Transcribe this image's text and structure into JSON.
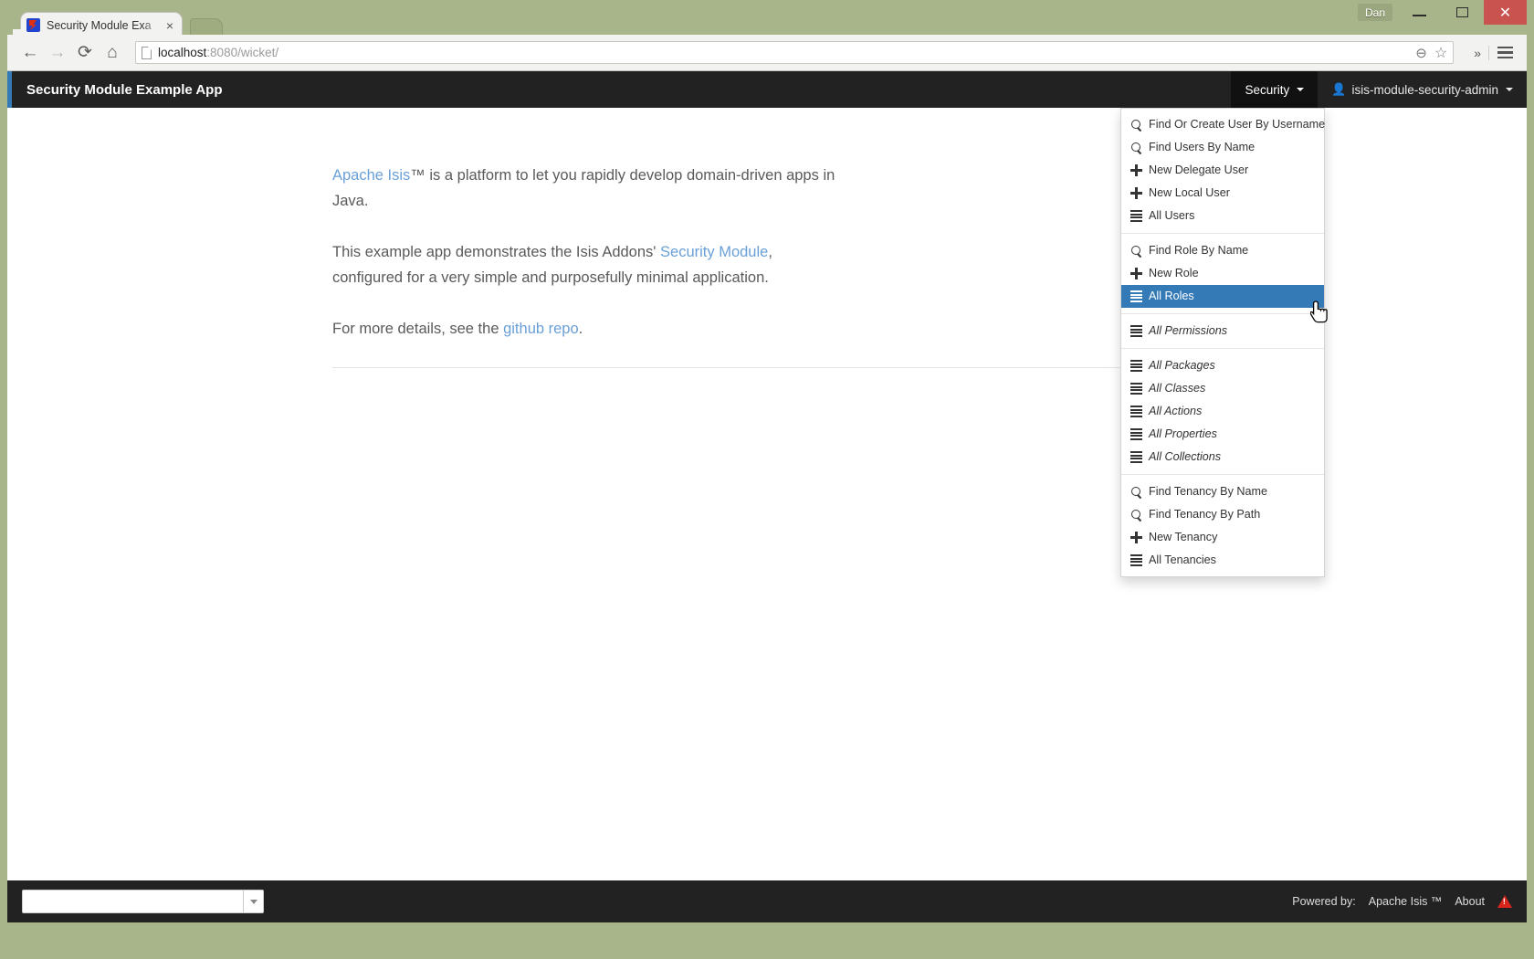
{
  "browser": {
    "tab": {
      "title": "Security Module Exa",
      "close_label": "×",
      "favicon": "isis-favicon"
    },
    "new_tab_label": "",
    "window_controls": {
      "user_label": "Dan",
      "minimize_label": "—",
      "maximize_label": "",
      "close_label": "✕"
    },
    "toolbar": {
      "back_label": "←",
      "forward_label": "→",
      "reload_label": "⟳",
      "home_label": "⌂",
      "url_host": "localhost",
      "url_rest": ":8080/wicket/",
      "zoom_icon_label": "⊖",
      "bookmark_icon_label": "☆",
      "overflow_label": "»",
      "menu_label": ""
    }
  },
  "app": {
    "brand": "Security Module Example App",
    "accent_color": "#337ab7",
    "navbar_background": "#222222",
    "nav": {
      "security_label": "Security",
      "user_label": "isis-module-security-admin"
    }
  },
  "dropdown": {
    "groups": [
      {
        "items": [
          {
            "label": "Find Or Create User By Username",
            "icon": "search-icon",
            "italic": false,
            "active": false
          },
          {
            "label": "Find Users By Name",
            "icon": "search-icon",
            "italic": false,
            "active": false
          },
          {
            "label": "New Delegate User",
            "icon": "plus-icon",
            "italic": false,
            "active": false
          },
          {
            "label": "New Local User",
            "icon": "plus-icon",
            "italic": false,
            "active": false
          },
          {
            "label": "All Users",
            "icon": "list-icon",
            "italic": false,
            "active": false
          }
        ]
      },
      {
        "items": [
          {
            "label": "Find Role By Name",
            "icon": "search-icon",
            "italic": false,
            "active": false
          },
          {
            "label": "New Role",
            "icon": "plus-icon",
            "italic": false,
            "active": false
          },
          {
            "label": "All Roles",
            "icon": "list-icon",
            "italic": false,
            "active": true
          }
        ]
      },
      {
        "items": [
          {
            "label": "All Permissions",
            "icon": "list-icon",
            "italic": true,
            "active": false
          }
        ]
      },
      {
        "items": [
          {
            "label": "All Packages",
            "icon": "list-icon",
            "italic": true,
            "active": false
          },
          {
            "label": "All Classes",
            "icon": "list-icon",
            "italic": true,
            "active": false
          },
          {
            "label": "All Actions",
            "icon": "list-icon",
            "italic": true,
            "active": false
          },
          {
            "label": "All Properties",
            "icon": "list-icon",
            "italic": true,
            "active": false
          },
          {
            "label": "All Collections",
            "icon": "list-icon",
            "italic": true,
            "active": false
          }
        ]
      },
      {
        "items": [
          {
            "label": "Find Tenancy By Name",
            "icon": "search-icon",
            "italic": false,
            "active": false
          },
          {
            "label": "Find Tenancy By Path",
            "icon": "search-icon",
            "italic": false,
            "active": false
          },
          {
            "label": "New Tenancy",
            "icon": "plus-icon",
            "italic": false,
            "active": false
          },
          {
            "label": "All Tenancies",
            "icon": "list-icon",
            "italic": false,
            "active": false
          }
        ]
      }
    ],
    "highlight_color": "#337ab7"
  },
  "content": {
    "paragraphs": [
      {
        "parts": [
          {
            "text": "Apache Isis",
            "link": true
          },
          {
            "text": "™ is a platform to let you rapidly develop domain-driven apps in Java.",
            "link": false
          }
        ]
      },
      {
        "parts": [
          {
            "text": "This example app demonstrates the Isis Addons' ",
            "link": false
          },
          {
            "text": "Security Module",
            "link": true
          },
          {
            "text": ", configured for a very simple and purposefully minimal application.",
            "link": false
          }
        ]
      },
      {
        "parts": [
          {
            "text": "For more details, see the ",
            "link": false
          },
          {
            "text": "github repo",
            "link": true
          },
          {
            "text": ".",
            "link": false
          }
        ]
      }
    ]
  },
  "footer": {
    "select_value": "",
    "powered_by_label": "Powered by:",
    "powered_by_link": "Apache Isis ™",
    "about_label": "About",
    "warning_icon": "warning-triangle-icon"
  }
}
